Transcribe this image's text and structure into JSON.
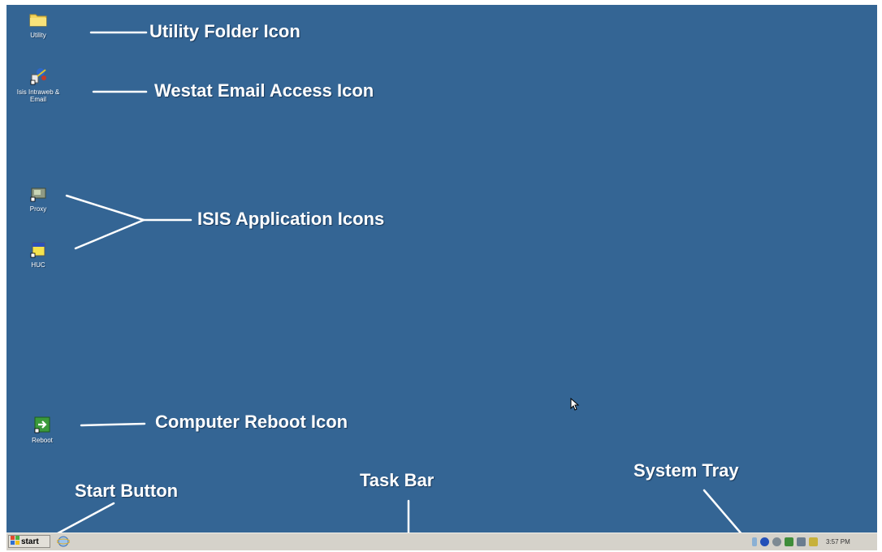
{
  "desktop": {
    "background_color": "#346594",
    "icons": [
      {
        "name": "utility-folder",
        "label": "Utility",
        "icon": "folder-icon"
      },
      {
        "name": "email-access",
        "label": "Isis Intraweb & Email",
        "icon": "email-access-icon"
      },
      {
        "name": "proxy",
        "label": "Proxy",
        "icon": "proxy-app-icon"
      },
      {
        "name": "huc",
        "label": "HUC",
        "icon": "huc-app-icon"
      },
      {
        "name": "reboot",
        "label": "Reboot",
        "icon": "reboot-icon"
      }
    ]
  },
  "annotations": {
    "utility_folder": "Utility Folder Icon",
    "email_access": "Westat Email Access Icon",
    "isis_apps": "ISIS Application Icons",
    "reboot": "Computer Reboot Icon",
    "start_button": "Start Button",
    "task_bar": "Task Bar",
    "system_tray": "System Tray"
  },
  "taskbar": {
    "start_label": "start",
    "quick_launch_icon": "internet-explorer-icon",
    "tray_icons": [
      "network-icon",
      "messenger-icon",
      "antivirus-icon",
      "volume-icon",
      "printer-icon",
      "security-icon"
    ],
    "clock": "3:57 PM"
  }
}
